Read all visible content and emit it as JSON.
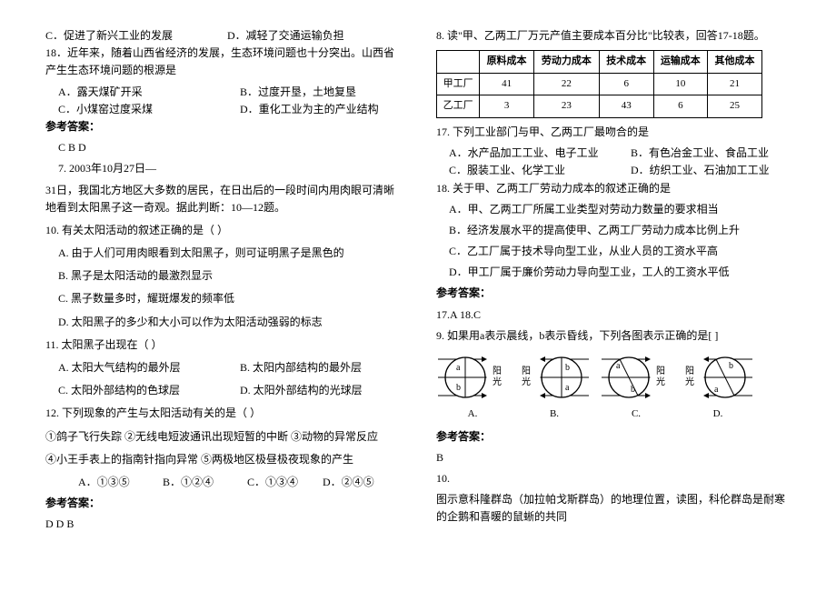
{
  "left": {
    "q_line1_c": "C．促进了新兴工业的发展",
    "q_line1_d": "D．减轻了交通运输负担",
    "q18": "18．近年来，随着山西省经济的发展，生态环境问题也十分突出。山西省产生生态环境问题的根源是",
    "q18_a": "A．露天煤矿开采",
    "q18_b": "B．过度开垦，土地复垦",
    "q18_c": "C．小煤窑过度采煤",
    "q18_d": "D．重化工业为主的产业结构",
    "ans_label": "参考答案：",
    "ans1": "C  B  D",
    "q7": "7. 2003年10月27日—",
    "q7_cont": "31日，我国北方地区大多数的居民，在日出后的一段时间内用肉眼可清晰地看到太阳黑子这一奇观。据此判断：10—12题。",
    "q10": "10. 有关太阳活动的叙述正确的是（     ）",
    "q10_a": "A. 由于人们可用肉眼看到太阳黑子，则可证明黑子是黑色的",
    "q10_b": "B. 黑子是太阳活动的最激烈显示",
    "q10_c": "C. 黑子数量多时，耀斑爆发的频率低",
    "q10_d": "D. 太阳黑子的多少和大小可以作为太阳活动强弱的标志",
    "q11": "11. 太阳黑子出现在（      ）",
    "q11_a": "A. 太阳大气结构的最外层",
    "q11_b": "B. 太阳内部结构的最外层",
    "q11_c": "C. 太阳外部结构的色球层",
    "q11_d": "D. 太阳外部结构的光球层",
    "q12": "12. 下列现象的产生与太阳活动有关的是（     ）",
    "q12_opts1": "①鸽子飞行失踪   ②无线电短波通讯出现短暂的中断    ③动物的异常反应",
    "q12_opts2": "④小王手表上的指南针指向异常     ⑤两极地区极昼极夜现象的产生",
    "q12_a": "A．①③⑤",
    "q12_b": "B．①②④",
    "q12_c": "C．①③④",
    "q12_d": "D．②④⑤",
    "ans2": "D  D  B"
  },
  "right": {
    "q8": "8. 读\"甲、乙两工厂万元产值主要成本百分比\"比较表，回答17-18题。",
    "table": {
      "headers": [
        "",
        "原料成本",
        "劳动力成本",
        "技术成本",
        "运输成本",
        "其他成本"
      ],
      "rows": [
        [
          "甲工厂",
          "41",
          "22",
          "6",
          "10",
          "21"
        ],
        [
          "乙工厂",
          "3",
          "23",
          "43",
          "6",
          "25"
        ]
      ]
    },
    "q17": "17. 下列工业部门与甲、乙两工厂最吻合的是",
    "q17_a": "A．水产品加工工业、电子工业",
    "q17_b": "B．有色冶金工业、食品工业",
    "q17_c": "C．服装工业、化学工业",
    "q17_d": "D．纺织工业、石油加工工业",
    "q18r": "18. 关于甲、乙两工厂劳动力成本的叙述正确的是",
    "q18r_a": "A．甲、乙两工厂所属工业类型对劳动力数量的要求相当",
    "q18r_b": "B．经济发展水平的提高使甲、乙两工厂劳动力成本比例上升",
    "q18r_c": "C．乙工厂属于技术导向型工业，从业人员的工资水平高",
    "q18r_d": "D．甲工厂属于廉价劳动力导向型工业，工人的工资水平低",
    "ans_label": "参考答案：",
    "ans17_18": "17.A   18.C",
    "q9": "9. 如果用a表示晨线，b表示昏线，下列各图表示正确的是[      ]",
    "diag_labels": {
      "a": "A.",
      "b": "B.",
      "c": "C.",
      "d": "D."
    },
    "sun": "阳",
    "light": "光",
    "ans9": "B",
    "q10r": "10.",
    "q10r_text": "图示意科隆群岛（加拉帕戈斯群岛）的地理位置，读图，科伦群岛是耐寒的企鹅和喜暖的鼠蜥的共同"
  }
}
